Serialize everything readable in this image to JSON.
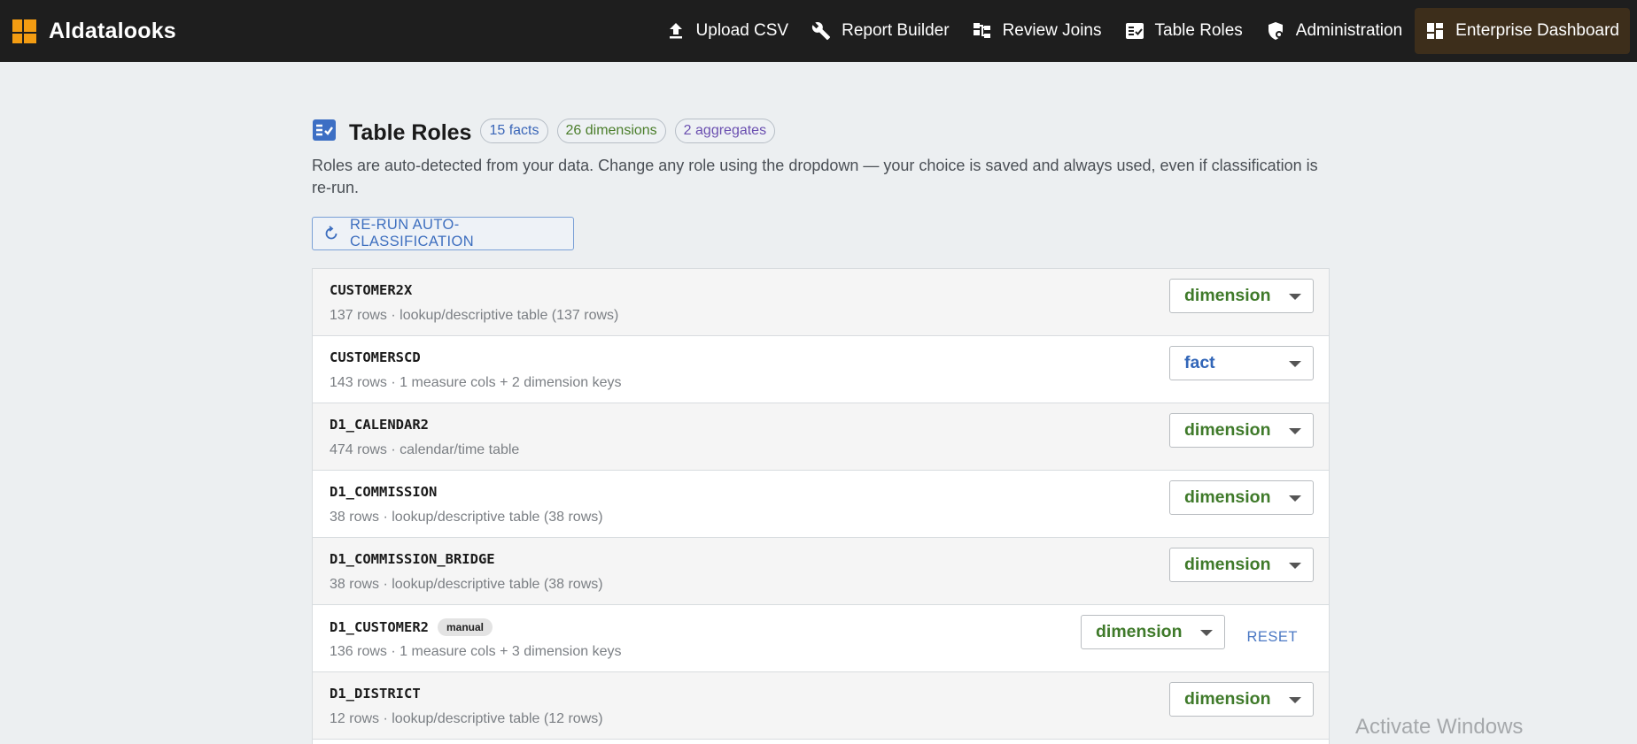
{
  "app": {
    "name": "Aldatalooks"
  },
  "nav": {
    "items": [
      {
        "label": "Upload CSV",
        "icon": "upload-icon"
      },
      {
        "label": "Report Builder",
        "icon": "wrench-icon"
      },
      {
        "label": "Review Joins",
        "icon": "hierarchy-icon"
      },
      {
        "label": "Table Roles",
        "icon": "table-check-icon"
      },
      {
        "label": "Administration",
        "icon": "shield-gear-icon"
      },
      {
        "label": "Enterprise Dashboard",
        "icon": "dashboard-icon",
        "active": true
      }
    ]
  },
  "header": {
    "title": "Table Roles",
    "chips": {
      "facts": "15 facts",
      "dimensions": "26 dimensions",
      "aggregates": "2 aggregates"
    },
    "description": "Roles are auto-detected from your data. Change any role using the dropdown — your choice is saved and always used, even if classification is re-run.",
    "rerun_label": "RE-RUN AUTO-CLASSIFICATION"
  },
  "tables": [
    {
      "name": "CUSTOMER2X",
      "meta": "137 rows · lookup/descriptive table (137 rows)",
      "role": "dimension"
    },
    {
      "name": "CUSTOMERSCD",
      "meta": "143 rows · 1 measure cols + 2 dimension keys",
      "role": "fact"
    },
    {
      "name": "D1_CALENDAR2",
      "meta": "474 rows · calendar/time table",
      "role": "dimension"
    },
    {
      "name": "D1_COMMISSION",
      "meta": "38 rows · lookup/descriptive table (38 rows)",
      "role": "dimension"
    },
    {
      "name": "D1_COMMISSION_BRIDGE",
      "meta": "38 rows · lookup/descriptive table (38 rows)",
      "role": "dimension"
    },
    {
      "name": "D1_CUSTOMER2",
      "meta": "136 rows · 1 measure cols + 3 dimension keys",
      "role": "dimension",
      "badge": "manual",
      "reset_label": "RESET"
    },
    {
      "name": "D1_DISTRICT",
      "meta": "12 rows · lookup/descriptive table (12 rows)",
      "role": "dimension"
    }
  ],
  "watermark": "Activate Windows",
  "colors": {
    "accent": "#f39c12",
    "dimension": "#3f7a2a",
    "fact": "#3266b8",
    "link": "#4c79c4"
  }
}
